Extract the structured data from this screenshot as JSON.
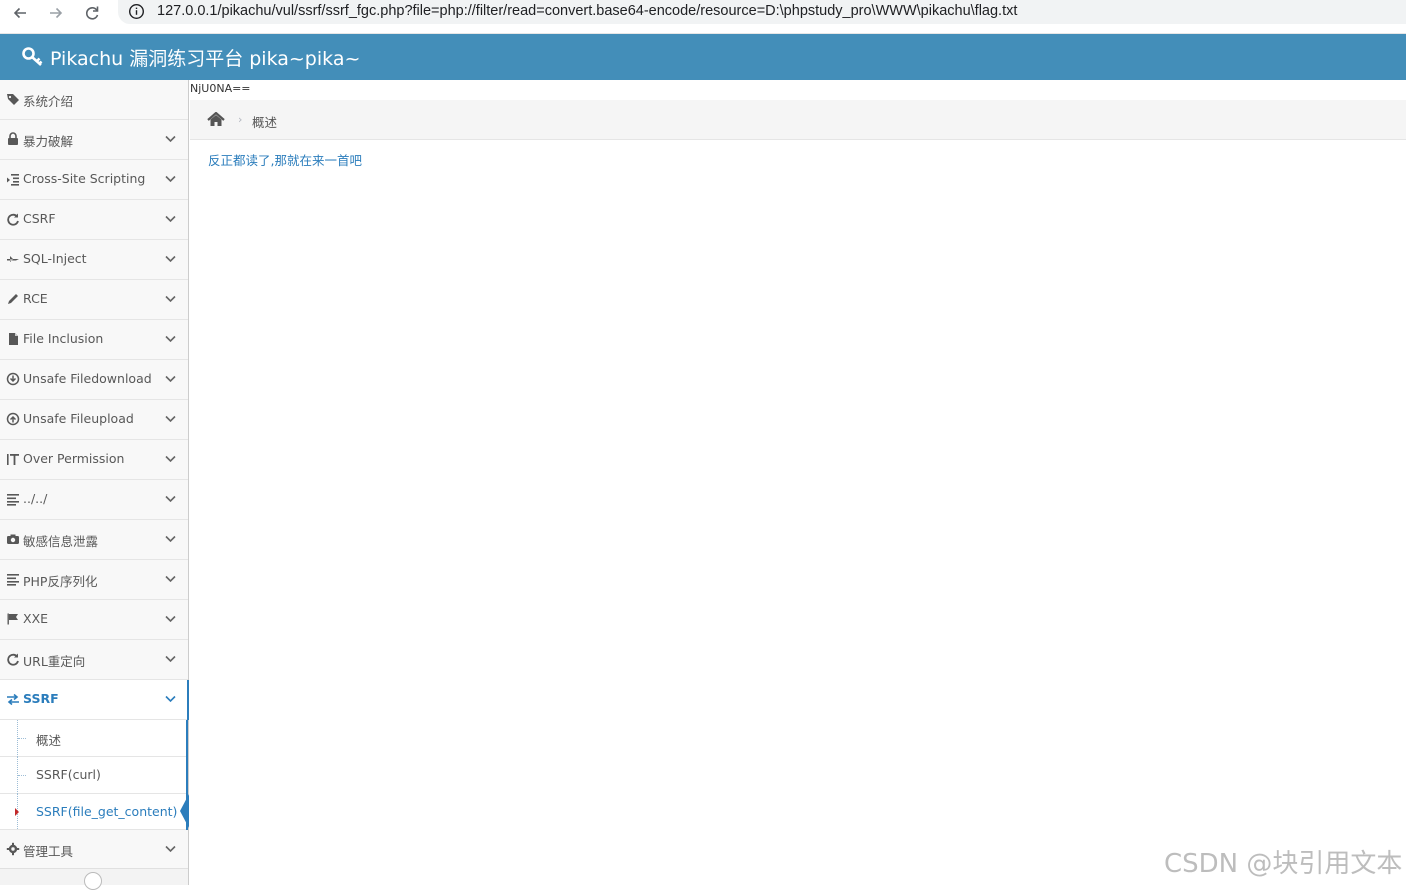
{
  "browser": {
    "url": "127.0.0.1/pikachu/vul/ssrf/ssrf_fgc.php?file=php://filter/read=convert.base64-encode/resource=D:\\phpstudy_pro\\WWW\\pikachu\\flag.txt"
  },
  "header": {
    "title": "Pikachu 漏洞练习平台 pika~pika~"
  },
  "sidebar": {
    "items": [
      {
        "label": "系统介绍",
        "icon": "tag-icon",
        "expandable": false
      },
      {
        "label": "暴力破解",
        "icon": "lock-icon",
        "expandable": true
      },
      {
        "label": "Cross-Site Scripting",
        "icon": "indent-icon",
        "expandable": true
      },
      {
        "label": "CSRF",
        "icon": "refresh-icon",
        "expandable": true
      },
      {
        "label": "SQL-Inject",
        "icon": "fighter-jet-icon",
        "expandable": true
      },
      {
        "label": "RCE",
        "icon": "pencil-icon",
        "expandable": true
      },
      {
        "label": "File Inclusion",
        "icon": "file-icon",
        "expandable": true
      },
      {
        "label": "Unsafe Filedownload",
        "icon": "download-circle-icon",
        "expandable": true
      },
      {
        "label": "Unsafe Fileupload",
        "icon": "upload-circle-icon",
        "expandable": true
      },
      {
        "label": "Over Permission",
        "icon": "text-height-icon",
        "expandable": true
      },
      {
        "label": "../../",
        "icon": "align-left-icon",
        "expandable": true
      },
      {
        "label": "敏感信息泄露",
        "icon": "camera-icon",
        "expandable": true
      },
      {
        "label": "PHP反序列化",
        "icon": "align-left-icon",
        "expandable": true
      },
      {
        "label": "XXE",
        "icon": "flag-icon",
        "expandable": true
      },
      {
        "label": "URL重定向",
        "icon": "refresh-icon",
        "expandable": true
      },
      {
        "label": "SSRF",
        "icon": "exchange-icon",
        "expandable": true,
        "active": true
      }
    ],
    "ssrf_submenu": [
      {
        "label": "概述"
      },
      {
        "label": "SSRF(curl)"
      },
      {
        "label": "SSRF(file_get_content)",
        "active": true
      }
    ],
    "tools_item": {
      "label": "管理工具",
      "icon": "cog-icon"
    }
  },
  "main": {
    "raw_output": "NjU0NA==",
    "breadcrumb": "概述",
    "breadcrumb_separator": "›",
    "content_link": "反正都读了,那就在来一首吧"
  },
  "watermark": "CSDN @块引用文本",
  "colors": {
    "header_bg": "#438eb9",
    "accent": "#2b7dbc",
    "sidebar_bg": "#f8f8f8"
  }
}
